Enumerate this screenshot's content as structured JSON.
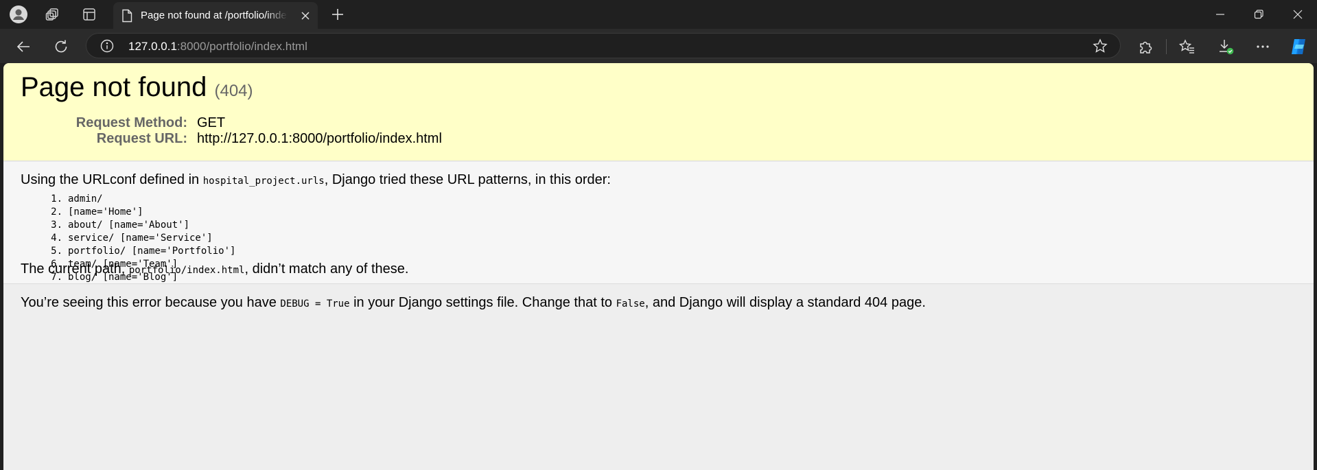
{
  "browser": {
    "tab": {
      "title": "Page not found at /portfolio/index.html"
    },
    "address_bar": {
      "host": "127.0.0.1",
      "rest": ":8000/portfolio/index.html"
    },
    "icons": {
      "profile": "profile-icon",
      "workspaces": "workspaces-icon",
      "tab_actions": "tab-actions-icon",
      "page": "page-icon",
      "close_tab": "close-icon",
      "new_tab": "plus-icon",
      "minimize": "minimize-icon",
      "restore": "restore-icon",
      "close_window": "close-icon",
      "back": "back-arrow-icon",
      "refresh": "refresh-icon",
      "site_info": "info-icon",
      "favorite": "star-icon",
      "extensions": "puzzle-icon",
      "favorites": "favorites-icon",
      "downloads": "download-icon",
      "more": "more-icon",
      "copilot": "copilot-icon"
    },
    "colors": {
      "chrome_dark": "#202020",
      "toolbar": "#2b2b2b",
      "copilot": "#1fa0ff",
      "download_badge": "#3fb950"
    }
  },
  "page": {
    "title": "Page not found",
    "status_code": "(404)",
    "request": [
      {
        "label": "Request Method:",
        "value": "GET"
      },
      {
        "label": "Request URL:",
        "value": "http://127.0.0.1:8000/portfolio/index.html"
      }
    ],
    "urlconf": {
      "prefix": "Using the URLconf defined in ",
      "module": "hospital_project.urls",
      "suffix": ", Django tried these URL patterns, in this order:"
    },
    "patterns": [
      {
        "num": "1.",
        "text": "admin/"
      },
      {
        "num": "2.",
        "text": "[name='Home']"
      },
      {
        "num": "3.",
        "text": "about/ [name='About']"
      },
      {
        "num": "4.",
        "text": "service/ [name='Service']"
      },
      {
        "num": "5.",
        "text": "portfolio/ [name='Portfolio']"
      },
      {
        "num": "6.",
        "text": "team/ [name='Team']"
      },
      {
        "num": "7.",
        "text": "blog/ [name='Blog']"
      }
    ],
    "current_path": {
      "prefix": "The current path, ",
      "path": "portfolio/index.html",
      "suffix": ", didn’t match any of these."
    },
    "explanation": {
      "part1": "You’re seeing this error because you have ",
      "code1": "DEBUG = True",
      "part2": " in your Django settings file. Change that to ",
      "code2": "False",
      "part3": ", and Django will display a standard 404 page."
    },
    "colors": {
      "summary_bg": "#ffffc8",
      "info_bg": "#f6f6f6",
      "explanation_bg": "#eeeeee",
      "label": "#666666"
    }
  }
}
